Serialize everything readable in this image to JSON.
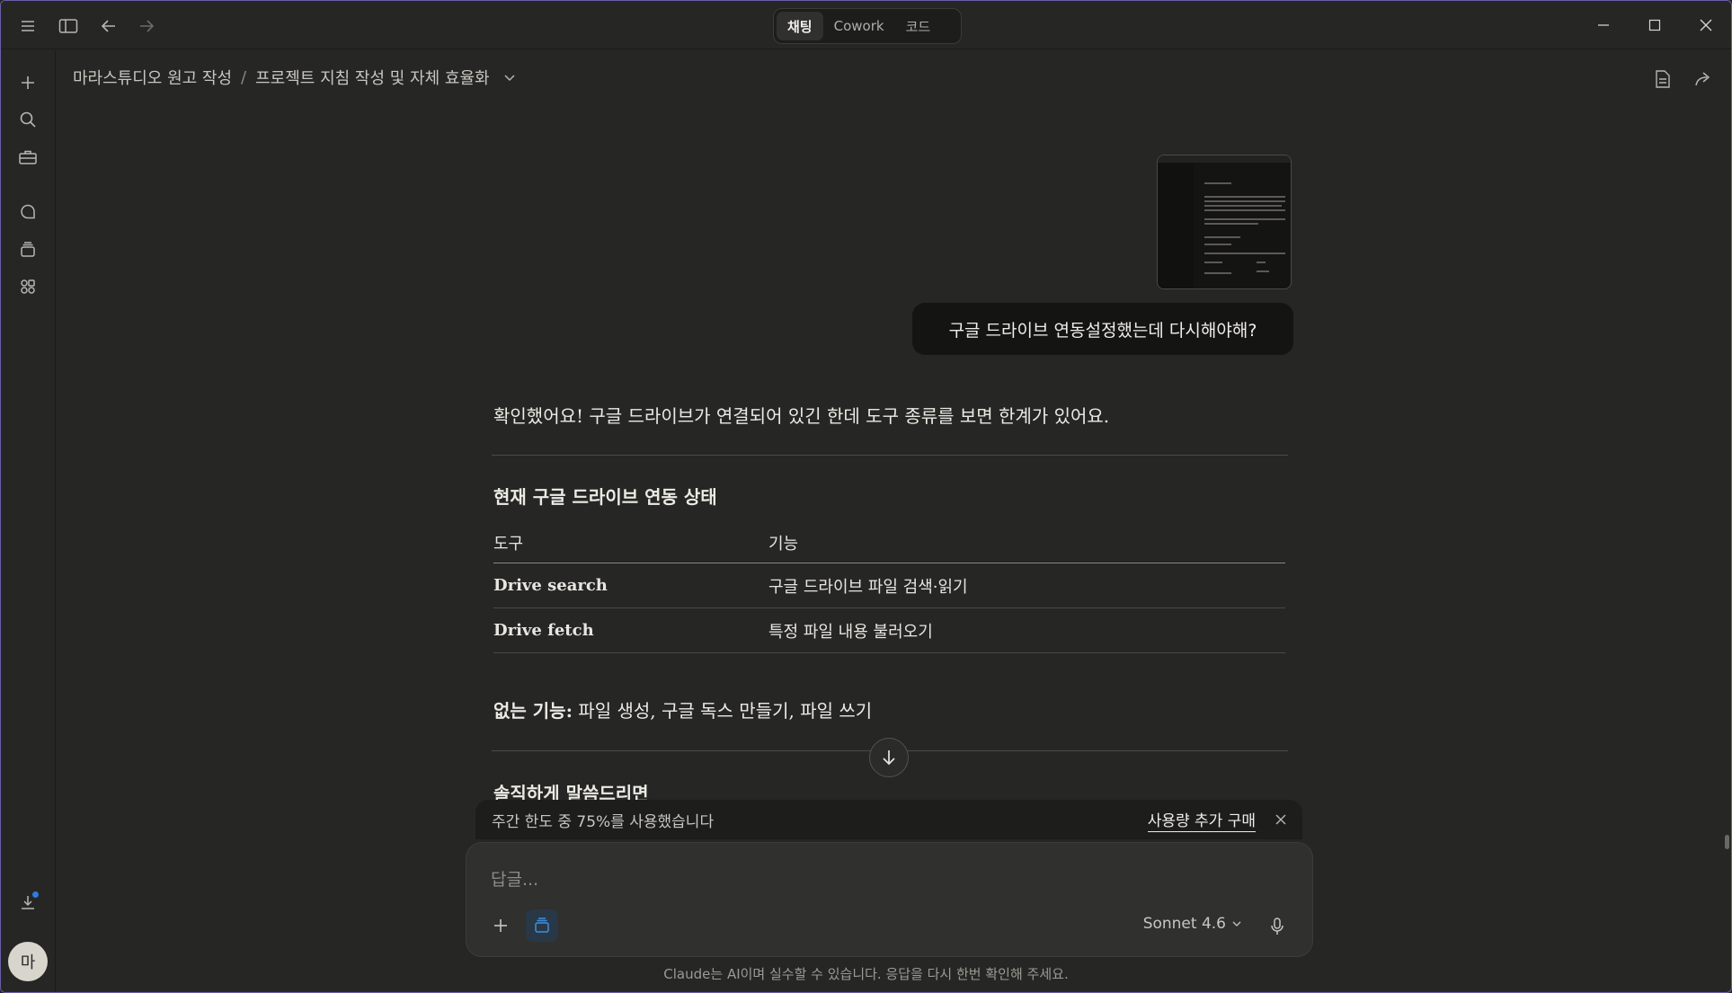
{
  "titlebar": {
    "modes": [
      {
        "label": "채팅",
        "active": true
      },
      {
        "label": "Cowork",
        "active": false
      },
      {
        "label": "코드",
        "active": false
      }
    ]
  },
  "breadcrumb": {
    "project": "마라스튜디오 원고 작성",
    "separator": "/",
    "conversation": "프로젝트 지침 작성 및 자체 효율화"
  },
  "chat": {
    "user_message": "구글 드라이브 연동설정했는데 다시해야해?",
    "answer_intro": "확인했어요! 구글 드라이브가 연결되어 있긴 한데 도구 종류를 보면 한계가 있어요.",
    "status_heading": "현재 구글 드라이브 연동 상태",
    "table": {
      "headers": [
        "도구",
        "기능"
      ],
      "rows": [
        [
          "Drive search",
          "구글 드라이브 파일 검색·읽기"
        ],
        [
          "Drive fetch",
          "특정 파일 내용 불러오기"
        ]
      ]
    },
    "missing_label": "없는 기능:",
    "missing_text": " 파일 생성, 구글 독스 만들기, 파일 쓰기",
    "honest_heading": "솔직하게 말씀드리면"
  },
  "usage_banner": {
    "text": "주간 한도 중 75%를 사용했습니다",
    "buy_label": "사용량 추가 구매",
    "weekly_used_percent": 75
  },
  "composer": {
    "placeholder": "답글...",
    "model": "Sonnet 4.6"
  },
  "disclaimer": "Claude는 AI이며 실수할 수 있습니다. 응답을 다시 한번 확인해 주세요.",
  "user": {
    "avatar_initial": "마"
  },
  "colors": {
    "accent_blue": "#2f7ae5",
    "background": "#262624",
    "bubble": "#141413"
  }
}
